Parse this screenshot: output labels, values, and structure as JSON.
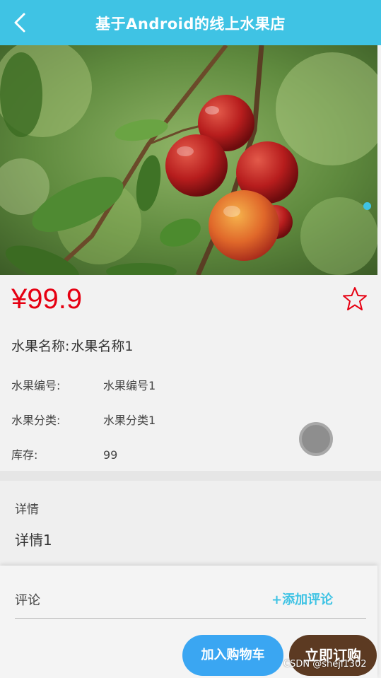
{
  "header": {
    "title": "基于Android的线上水果店",
    "back_icon": "chevron-left-icon"
  },
  "hero": {
    "image_subject": "plums on branch",
    "carousel_active_dot_color": "#3fc3e4"
  },
  "product": {
    "price": "¥99.9",
    "favorite_icon": "star-outline-icon",
    "name_label": "水果名称:",
    "name_value": "水果名称1",
    "fields": [
      {
        "label": "水果编号:",
        "value": "水果编号1"
      },
      {
        "label": "水果分类:",
        "value": "水果分类1"
      },
      {
        "label": "库存:",
        "value": "99"
      }
    ]
  },
  "detail": {
    "label": "详情",
    "text": "详情1"
  },
  "comments": {
    "label": "评论",
    "add_label": "+添加评论"
  },
  "actions": {
    "add_to_cart": "加入购物车",
    "buy_now": "立即订购"
  },
  "watermark": "CSDN @sheji1302",
  "colors": {
    "header_bg": "#3fc3e4",
    "price": "#e60012",
    "cart_button": "#3aa6f2",
    "buy_button": "#5c3a22"
  }
}
